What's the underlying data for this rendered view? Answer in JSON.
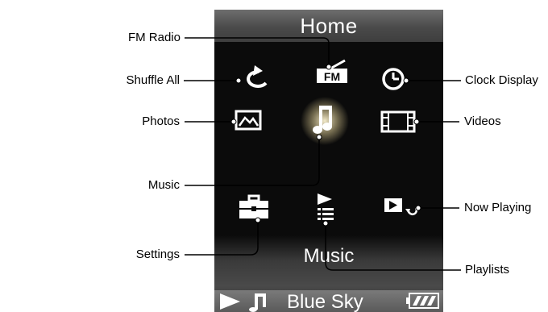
{
  "screen": {
    "title": "Home",
    "selected_label": "Music",
    "status": {
      "now_playing_text": "Blue Sky"
    },
    "icons": [
      "fm-radio-icon",
      "shuffle-all-icon",
      "clock-display-icon",
      "photos-icon",
      "music-icon",
      "videos-icon",
      "settings-icon",
      "playlists-icon",
      "now-playing-icon"
    ]
  },
  "callouts": {
    "fm_radio": "FM Radio",
    "shuffle_all": "Shuffle All",
    "photos": "Photos",
    "music": "Music",
    "settings": "Settings",
    "clock_display": "Clock Display",
    "videos": "Videos",
    "now_playing": "Now Playing",
    "playlists": "Playlists"
  },
  "colors": {
    "screen_bg": "#0b0b0b",
    "icon": "#ffffff",
    "music_glow": "#f4e6b2",
    "callout_line": "#000000"
  }
}
